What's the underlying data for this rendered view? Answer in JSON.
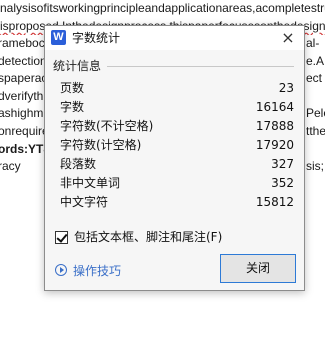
{
  "background_document": {
    "top_lines": [
      "nalysisofitsworkingprincipleandapplicationareas,acompletestruct",
      "isproposed.Inthedesignprocess,thispaperfocusesonthedesignoft"
    ],
    "left_fragments": [
      "rameboc",
      "detection",
      "spaperac",
      "dverifyth",
      "ashighm",
      "onrequire",
      "ords:YT8",
      "racy"
    ],
    "right_fragments": [
      "al-",
      "e.A",
      "ect",
      "",
      "Pele",
      "tthe",
      "",
      "sis;"
    ]
  },
  "dialog": {
    "app_icon_letter": "W",
    "title": "字数统计",
    "close_icon": "×",
    "group_label": "统计信息",
    "stats": [
      {
        "label": "页数",
        "value": "23"
      },
      {
        "label": "字数",
        "value": "16164"
      },
      {
        "label": "字符数(不计空格)",
        "value": "17888"
      },
      {
        "label": "字符数(计空格)",
        "value": "17920"
      },
      {
        "label": "段落数",
        "value": "327"
      },
      {
        "label": "非中文单词",
        "value": "352"
      },
      {
        "label": "中文字符",
        "value": "15812"
      }
    ],
    "checkbox_label": "包括文本框、脚注和尾注(F)",
    "checkbox_checked": true,
    "tips_label": "操作技巧",
    "close_button_label": "关闭"
  },
  "colors": {
    "accent": "#2d7ad6",
    "link": "#3a6fc8",
    "app_icon": "#2b5fd9"
  }
}
